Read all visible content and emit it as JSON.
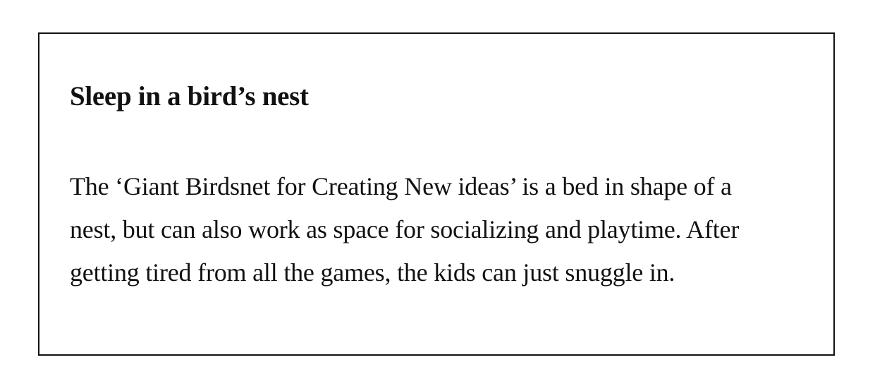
{
  "article": {
    "title": "Sleep in a bird’s nest",
    "body_lines": [
      "The ‘Giant Birdsnet for Creating New ideas’ is a bed in shape of a",
      "nest, but can also work as space for socializing and playtime. After",
      "getting tired from all the games, the kids can just snuggle in."
    ]
  }
}
